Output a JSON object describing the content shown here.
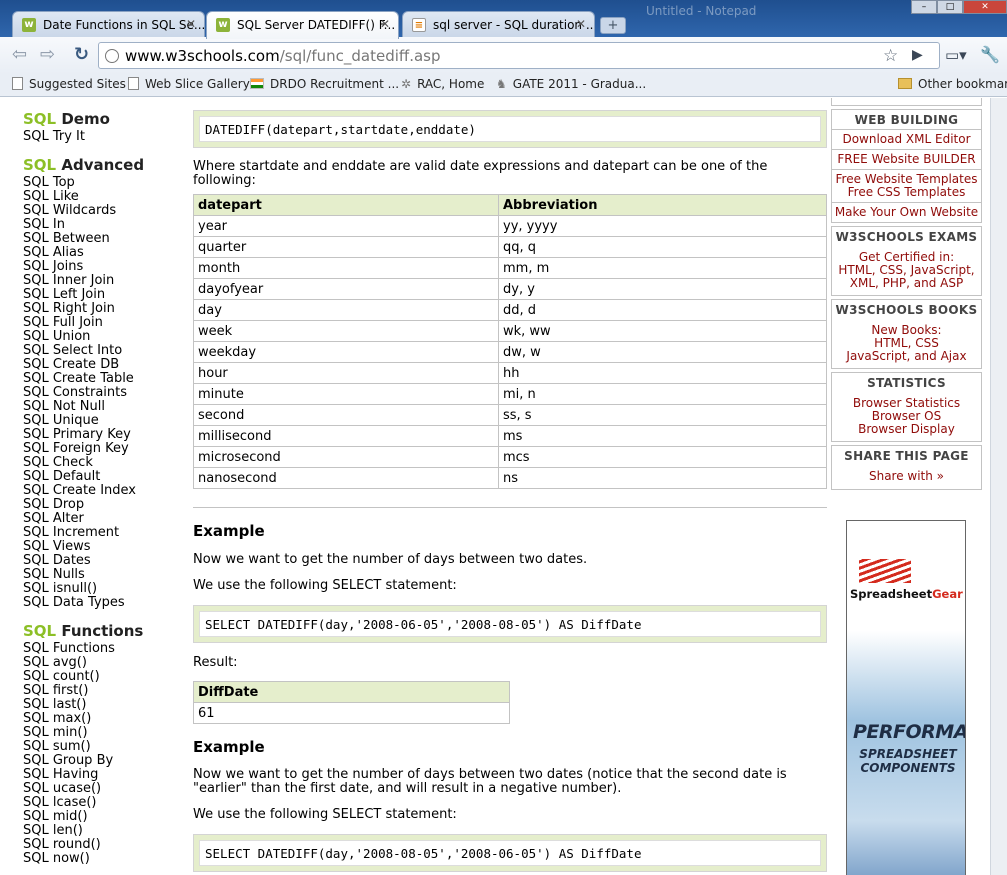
{
  "browser": {
    "tabs": [
      {
        "title": "Date Functions in SQL Se...",
        "icon": "sql-fav"
      },
      {
        "title": "SQL Server DATEDIFF() F...",
        "icon": "w3-fav",
        "active": true
      },
      {
        "title": "sql server - SQL duration ...",
        "icon": "stackoverflow-fav"
      }
    ],
    "ghost_window_title": "Untitled - Notepad",
    "url_host": "www.w3schools.com",
    "url_path": "/sql/func_datediff.asp",
    "bookmarks": [
      {
        "label": "Suggested Sites",
        "icon": "page-icon"
      },
      {
        "label": "Web Slice Gallery",
        "icon": "page-icon"
      },
      {
        "label": "DRDO Recruitment ...",
        "icon": "flag-icon"
      },
      {
        "label": "RAC, Home",
        "icon": "gear-icon"
      },
      {
        "label": "GATE 2011 - Gradua...",
        "icon": "deer-icon"
      }
    ],
    "other_bookmarks": "Other bookmarks"
  },
  "leftnav": {
    "groups": [
      {
        "prefix": "SQL",
        "heading": " Demo",
        "items": [
          "SQL Try It"
        ]
      },
      {
        "prefix": "SQL",
        "heading": " Advanced",
        "items": [
          "SQL Top",
          "SQL Like",
          "SQL Wildcards",
          "SQL In",
          "SQL Between",
          "SQL Alias",
          "SQL Joins",
          "SQL Inner Join",
          "SQL Left Join",
          "SQL Right Join",
          "SQL Full Join",
          "SQL Union",
          "SQL Select Into",
          "SQL Create DB",
          "SQL Create Table",
          "SQL Constraints",
          "SQL Not Null",
          "SQL Unique",
          "SQL Primary Key",
          "SQL Foreign Key",
          "SQL Check",
          "SQL Default",
          "SQL Create Index",
          "SQL Drop",
          "SQL Alter",
          "SQL Increment",
          "SQL Views",
          "SQL Dates",
          "SQL Nulls",
          "SQL isnull()",
          "SQL Data Types"
        ]
      },
      {
        "prefix": "SQL",
        "heading": " Functions",
        "items": [
          "SQL Functions",
          "SQL avg()",
          "SQL count()",
          "SQL first()",
          "SQL last()",
          "SQL max()",
          "SQL min()",
          "SQL sum()",
          "SQL Group By",
          "SQL Having",
          "SQL ucase()",
          "SQL lcase()",
          "SQL mid()",
          "SQL len()",
          "SQL round()",
          "SQL now()"
        ]
      }
    ]
  },
  "main": {
    "syntax": "DATEDIFF(datepart,startdate,enddate)",
    "where_text": "Where startdate and enddate are valid date expressions and datepart can be one of the following:",
    "datepart_table": {
      "headers": [
        "datepart",
        "Abbreviation"
      ],
      "rows": [
        [
          "year",
          "yy, yyyy"
        ],
        [
          "quarter",
          "qq, q"
        ],
        [
          "month",
          "mm, m"
        ],
        [
          "dayofyear",
          "dy, y"
        ],
        [
          "day",
          "dd, d"
        ],
        [
          "week",
          "wk, ww"
        ],
        [
          "weekday",
          "dw, w"
        ],
        [
          "hour",
          "hh"
        ],
        [
          "minute",
          "mi, n"
        ],
        [
          "second",
          "ss, s"
        ],
        [
          "millisecond",
          "ms"
        ],
        [
          "microsecond",
          "mcs"
        ],
        [
          "nanosecond",
          "ns"
        ]
      ]
    },
    "example1": {
      "heading": "Example",
      "intro": "Now we want to get the number of days between two dates.",
      "select_text": "We use the following SELECT statement:",
      "code": "SELECT DATEDIFF(day,'2008-06-05','2008-08-05') AS DiffDate",
      "result_label": "Result:",
      "result_header": "DiffDate",
      "result_value": "61"
    },
    "example2": {
      "heading": "Example",
      "intro_line1": "Now we want to get the number of days between two dates (notice that the second date is",
      "intro_line2": "\"earlier\" than the first date, and will result in a negative number).",
      "select_text": "We use the following SELECT statement:",
      "code": "SELECT DATEDIFF(day,'2008-08-05','2008-06-05') AS DiffDate"
    }
  },
  "rightcol": {
    "web_building": {
      "title": "WEB BUILDING",
      "links": [
        "Download XML Editor",
        "FREE Website BUILDER",
        "Free Website Templates",
        "Free CSS Templates",
        "Make Your Own Website"
      ]
    },
    "exams": {
      "title": "W3SCHOOLS EXAMS",
      "line1": "Get Certified in:",
      "line2": "HTML, CSS, JavaScript,",
      "line3": "XML, PHP, and ASP"
    },
    "books": {
      "title": "W3SCHOOLS BOOKS",
      "line1": "New Books:",
      "line2": "HTML, CSS",
      "line3": "JavaScript, and Ajax"
    },
    "statistics": {
      "title": "STATISTICS",
      "links": [
        "Browser Statistics",
        "Browser OS",
        "Browser Display"
      ]
    },
    "share": {
      "title": "SHARE THIS PAGE",
      "link": "Share with »"
    },
    "ad": {
      "brand_black": "Spreadsheet",
      "brand_red": "Gear",
      "line1": "PERFORMANCE",
      "line2": "SPREADSHEET",
      "line3": "COMPONENTS"
    }
  }
}
